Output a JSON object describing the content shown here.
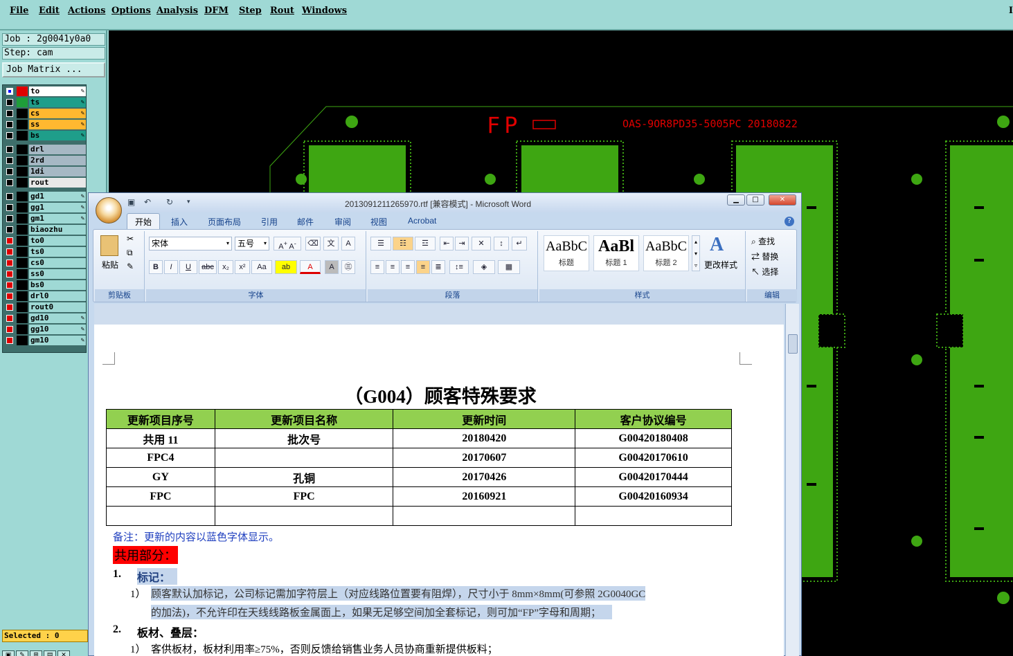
{
  "menubar": {
    "items": [
      "File",
      "Edit",
      "Actions",
      "Options",
      "Analysis",
      "DFM",
      "Step",
      "Rout",
      "Windows"
    ],
    "close": "I"
  },
  "job": {
    "job_label": "Job : 2g0041y0a0",
    "step_label": "Step: cam",
    "matrix_button": "Job Matrix ..."
  },
  "layers": [
    {
      "name": "to",
      "color": "#ffffff",
      "sw": "#e00000",
      "state": "on"
    },
    {
      "name": "ts",
      "color": "#1f9e8a",
      "sw": "#1f9e3a",
      "state": "off"
    },
    {
      "name": "cs",
      "color": "#ffb830",
      "sw": "#000000",
      "state": "off"
    },
    {
      "name": "ss",
      "color": "#ffb830",
      "sw": "#000000",
      "state": "off"
    },
    {
      "name": "bs",
      "color": "#1f9e8a",
      "sw": "#000000",
      "state": "off"
    },
    {
      "name": "drl",
      "color": "#a6b8c4",
      "sw": "#000000",
      "state": "off"
    },
    {
      "name": "2rd",
      "color": "#a6b8c4",
      "sw": "#000000",
      "state": "off"
    },
    {
      "name": "1di",
      "color": "#a6b8c4",
      "sw": "#000000",
      "state": "off"
    },
    {
      "name": "rout",
      "color": "#e8e8e8",
      "sw": "#000000",
      "state": "off"
    },
    {
      "name": "gd1",
      "color": "#9fd9d5",
      "sw": "#000000",
      "state": "off"
    },
    {
      "name": "gg1",
      "color": "#9fd9d5",
      "sw": "#000000",
      "state": "off"
    },
    {
      "name": "gm1",
      "color": "#9fd9d5",
      "sw": "#000000",
      "state": "off"
    },
    {
      "name": "biaozhu",
      "color": "#9fd9d5",
      "sw": "#000000",
      "state": "off"
    },
    {
      "name": "to0",
      "color": "#9fd9d5",
      "sw": "#000000",
      "state": "red"
    },
    {
      "name": "ts0",
      "color": "#9fd9d5",
      "sw": "#000000",
      "state": "red"
    },
    {
      "name": "cs0",
      "color": "#9fd9d5",
      "sw": "#000000",
      "state": "red"
    },
    {
      "name": "ss0",
      "color": "#9fd9d5",
      "sw": "#000000",
      "state": "red"
    },
    {
      "name": "bs0",
      "color": "#9fd9d5",
      "sw": "#000000",
      "state": "red"
    },
    {
      "name": "drl0",
      "color": "#9fd9d5",
      "sw": "#000000",
      "state": "red"
    },
    {
      "name": "rout0",
      "color": "#9fd9d5",
      "sw": "#000000",
      "state": "red"
    },
    {
      "name": "gd10",
      "color": "#9fd9d5",
      "sw": "#000000",
      "state": "red"
    },
    {
      "name": "gg10",
      "color": "#9fd9d5",
      "sw": "#000000",
      "state": "red"
    },
    {
      "name": "gm10",
      "color": "#9fd9d5",
      "sw": "#000000",
      "state": "red"
    }
  ],
  "selected": "Selected : 0",
  "canvas": {
    "fp_text": "FP",
    "code_text": "OAS-9OR8PD35-5005PC 20180822",
    "board_color": "#3ea612",
    "text_color": "#e00000"
  },
  "word": {
    "title": "2013091211265970.rtf [兼容模式] - Microsoft Word",
    "tabs": [
      "开始",
      "插入",
      "页面布局",
      "引用",
      "邮件",
      "审阅",
      "视图",
      "Acrobat"
    ],
    "clipboard": {
      "paste": "粘贴",
      "label": "剪贴板"
    },
    "font": {
      "name": "宋体",
      "size": "五号",
      "label": "字体"
    },
    "paragraph": {
      "label": "段落"
    },
    "styles": {
      "items": [
        {
          "preview": "AaBbC",
          "name": "标题"
        },
        {
          "preview": "AaBl",
          "name": "标题 1"
        },
        {
          "preview": "AaBbC",
          "name": "标题 2"
        }
      ],
      "change": "更改样式",
      "label": "样式"
    },
    "editing": {
      "find": "查找",
      "replace": "替换",
      "select": "选择",
      "label": "编辑"
    }
  },
  "doc": {
    "title": "（G004）顾客特殊要求",
    "headers": [
      "更新项目序号",
      "更新项目名称",
      "更新时间",
      "客户协议编号"
    ],
    "rows": [
      [
        "共用 11",
        "批次号",
        "20180420",
        "G00420180408"
      ],
      [
        "FPC4",
        "",
        "20170607",
        "G00420170610"
      ],
      [
        "GY",
        "孔铜",
        "20170426",
        "G00420170444"
      ],
      [
        "FPC",
        "FPC",
        "20160921",
        "G00420160934"
      ],
      [
        "",
        "",
        "",
        ""
      ]
    ],
    "note": "备注：更新的内容以蓝色字体显示。",
    "shared": "共用部分：",
    "s1_num": "1.",
    "s1_title": "标记：",
    "s1_1_num": "1）",
    "s1_1_line1": "顾客默认加标记，公司标记需加字符层上（对应线路位置要有阻焊），尺寸小于 8mm×8mm(可参照 2G0040GC",
    "s1_1_line2": "的加法)，不允许印在天线线路板金属面上，如果无足够空间加全套标记，则可加“FP”字母和周期；",
    "s2_num": "2.",
    "s2_title": "板材、叠层：",
    "s2_1_num": "1）",
    "s2_1_line": "客供板材，板材利用率≥75%，否则反馈给销售业务人员协商重新提供板料；"
  }
}
